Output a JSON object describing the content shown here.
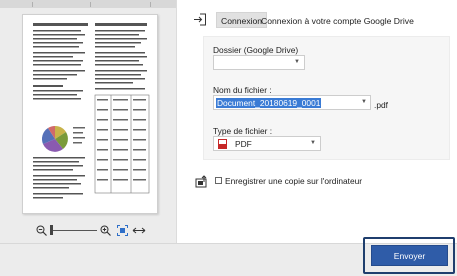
{
  "preview": {
    "zoom_out_icon": "zoom-out-icon",
    "zoom_in_icon": "zoom-in-icon",
    "fit_page_icon": "fit-page-icon",
    "fit_width_icon": "fit-width-icon"
  },
  "account": {
    "login_icon": "login-icon",
    "connect_label": "Connexion",
    "connect_text": "Connexion à votre compte Google Drive"
  },
  "form": {
    "folder_label": "Dossier (Google Drive)",
    "folder_value": "",
    "filename_label": "Nom du fichier :",
    "filename_value": "Document_20180619_0001",
    "filename_ext": ".pdf",
    "filetype_label": "Type de fichier :",
    "filetype_value": "PDF",
    "filetype_icon": "pdf-icon"
  },
  "save_copy": {
    "icon": "save-to-computer-icon",
    "checked": false,
    "label": "Enregistrer une copie sur l'ordinateur"
  },
  "actions": {
    "send_label": "Envoyer"
  },
  "colors": {
    "send_button": "#2f5ca8",
    "send_outline": "#1f3e6d",
    "selection": "#3a7bd5",
    "pdf_icon": "#c62828"
  }
}
